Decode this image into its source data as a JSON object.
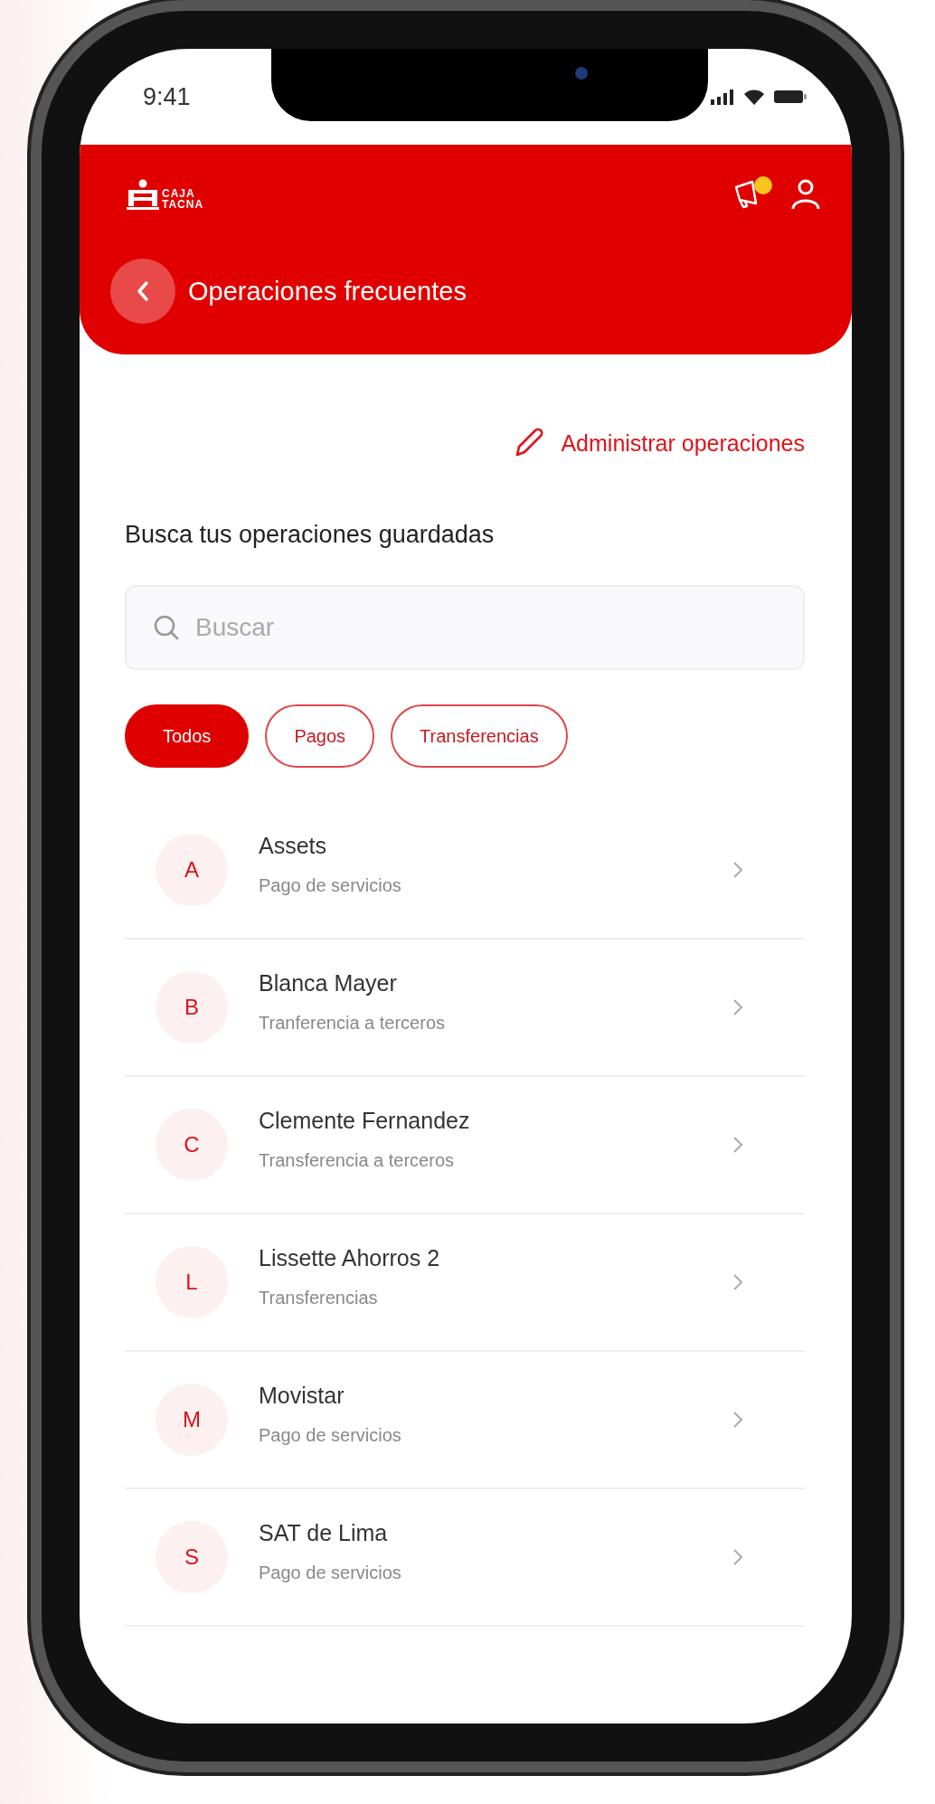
{
  "status_bar": {
    "time": "9:41"
  },
  "header": {
    "logo": {
      "line_1": "CAJA",
      "line_2": "TACNA"
    },
    "announcements": {
      "unread": true
    },
    "page_title": "Operaciones frecuentes"
  },
  "manage_link": "Administrar operaciones",
  "section_title": "Busca tus operaciones guardadas",
  "search": {
    "placeholder": "Buscar"
  },
  "filters": [
    {
      "label": "Todos",
      "selected": true
    },
    {
      "label": "Pagos",
      "selected": false
    },
    {
      "label": "Transferencias",
      "selected": false
    }
  ],
  "operations": [
    {
      "initial": "A",
      "name": "Assets",
      "type": "Pago de servicios"
    },
    {
      "initial": "B",
      "name": "Blanca Mayer",
      "type": "Tranferencia a terceros"
    },
    {
      "initial": "C",
      "name": "Clemente Fernandez",
      "type": "Transferencia a terceros"
    },
    {
      "initial": "L",
      "name": "Lissette Ahorros 2",
      "type": "Transferencias"
    },
    {
      "initial": "M",
      "name": "Movistar",
      "type": "Pago de servicios"
    },
    {
      "initial": "S",
      "name": "SAT de Lima",
      "type": "Pago de servicios"
    }
  ]
}
